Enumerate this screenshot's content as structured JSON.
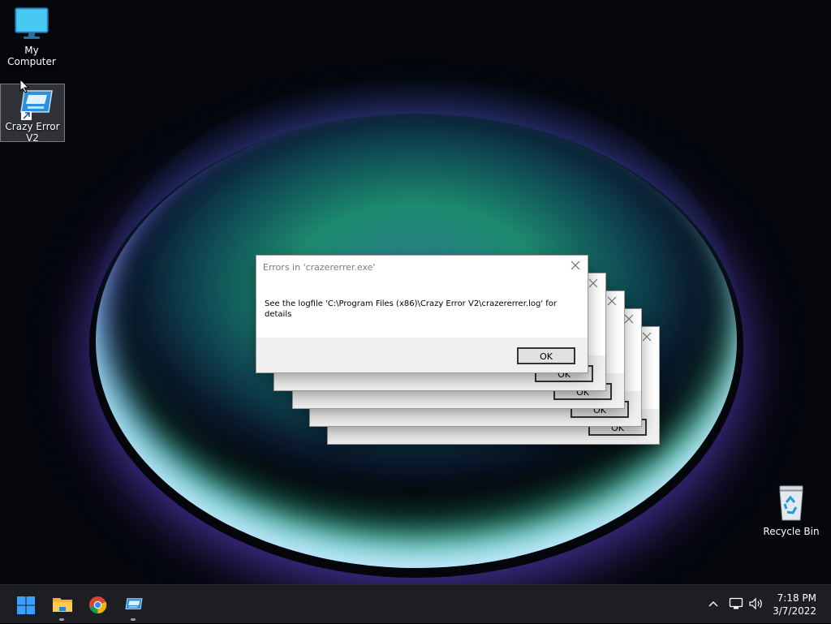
{
  "desktop": {
    "icons": [
      {
        "label": "My Computer",
        "icon": "monitor-icon"
      },
      {
        "label": "Crazy Error V2",
        "icon": "app-icon",
        "selected": true
      },
      {
        "label": "Recycle Bin",
        "icon": "recycle-bin-icon"
      }
    ]
  },
  "dialog": {
    "title": "Errors in 'crazererrer.exe'",
    "message": "See the logfile 'C:\\Program Files (x86)\\Crazy Error V2\\crazererrer.log' for details",
    "ok_label": "OK",
    "stack_count": 5
  },
  "taskbar": {
    "apps": [
      {
        "name": "Start",
        "icon": "windows-start-icon"
      },
      {
        "name": "File Explorer",
        "icon": "folder-icon",
        "running": true
      },
      {
        "name": "Google Chrome",
        "icon": "chrome-icon"
      },
      {
        "name": "Crazy Error V2",
        "icon": "app-icon",
        "running": true
      }
    ],
    "tray": {
      "icons": [
        "chevron-up-icon",
        "network-icon",
        "volume-icon"
      ],
      "time": "7:18 PM",
      "date": "3/7/2022"
    }
  },
  "colors": {
    "accent": "#0078d4",
    "taskbar": "#1d1e21"
  }
}
